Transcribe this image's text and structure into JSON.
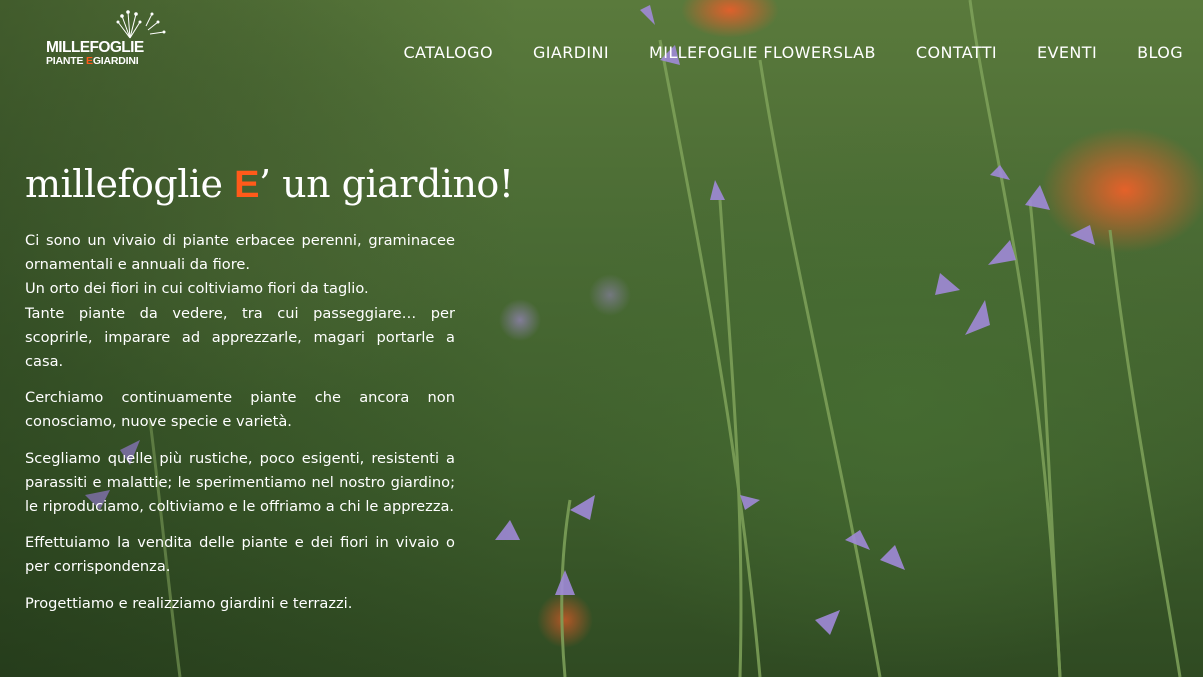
{
  "brand": {
    "name": "MILLEFOGLIE",
    "tagline_part1": "PIANTE ",
    "tagline_accent": "E",
    "tagline_part2": "GIARDINI"
  },
  "nav": {
    "items": [
      {
        "label": "CATALOGO"
      },
      {
        "label": "GIARDINI"
      },
      {
        "label": "MILLEFOGLIE FLOWERSLAB"
      },
      {
        "label": "CONTATTI"
      },
      {
        "label": "EVENTI"
      },
      {
        "label": "BLOG"
      }
    ]
  },
  "hero": {
    "title_part1": "millefoglie ",
    "title_accent": "E",
    "title_part2": "’ un giardino!"
  },
  "paragraphs": [
    {
      "lines": [
        "Ci sono un vivaio di piante erbacee perenni, graminacee ornamentali e annuali da fiore.",
        "Un orto dei fiori in cui coltiviamo fiori da taglio.",
        "Tante piante da vedere, tra cui passeggiare… per scoprirle, imparare ad apprezzarle, magari portarle a casa."
      ]
    },
    {
      "text": "Cerchiamo continuamente piante che ancora non conosciamo, nuove specie e varietà."
    },
    {
      "text": "Scegliamo quelle più rustiche, poco esigenti, resistenti a parassiti e malattie; le sperimentiamo nel nostro giardino; le riproduciamo, coltiviamo e le offriamo a chi le apprezza."
    },
    {
      "text": "Effettuiamo la vendita delle piante e dei fiori in vivaio o per corrispondenza."
    },
    {
      "text": "Progettiamo e realizziamo giardini e terrazzi."
    }
  ],
  "colors": {
    "accent": "#ff5a1a",
    "text": "#ffffff",
    "background_green": "#4a6b34",
    "flower_purple": "#9b86d6"
  },
  "icons": {
    "logo_mark": "dandelion-icon"
  }
}
